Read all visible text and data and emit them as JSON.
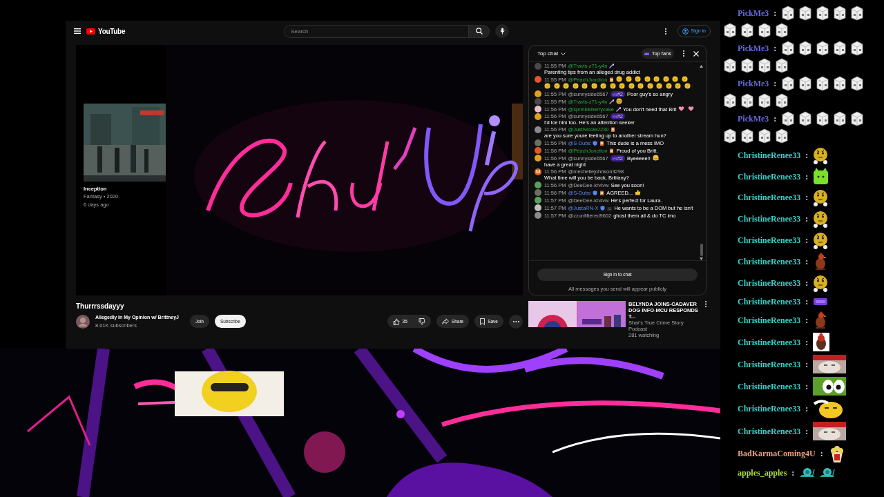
{
  "browser": {
    "logo": "YouTube",
    "search": {
      "placeholder": "Search"
    },
    "sign_in": "Sign in"
  },
  "player": {
    "suggestion": {
      "title": "Inception",
      "meta": "Fantasy • 2020",
      "age": "6 days ago"
    }
  },
  "video": {
    "title": "Thurrrssdayyy",
    "channel": "Allegedly In My Opinion w/ BrittneyJ",
    "subscribers": "8.01K subscribers",
    "join": "Join",
    "subscribe": "Subscribe",
    "likes": "35",
    "share": "Share",
    "save": "Save"
  },
  "chat": {
    "title": "Top chat",
    "filter": "Top fans",
    "messages": [
      {
        "time": "11:55 PM",
        "author": "@Travis-z71-y4n",
        "member": true,
        "moderator": false,
        "color": "#4a4a4a",
        "badges": [
          {
            "kind": "wand"
          }
        ],
        "parts": [
          {
            "kind": "text",
            "text": "Parenting tips from an alleged drug addict"
          }
        ]
      },
      {
        "time": "11:55 PM",
        "author": "@PeachJunction",
        "member": true,
        "moderator": false,
        "color": "#e0552a",
        "badges": [
          {
            "kind": "drink"
          }
        ],
        "parts": [
          {
            "kind": "clap"
          },
          {
            "kind": "clap"
          },
          {
            "kind": "clap"
          },
          {
            "kind": "clap"
          },
          {
            "kind": "clap"
          },
          {
            "kind": "clap"
          },
          {
            "kind": "clap"
          },
          {
            "kind": "clap"
          },
          {
            "kind": "clap"
          },
          {
            "kind": "clap"
          },
          {
            "kind": "clap"
          },
          {
            "kind": "clap"
          },
          {
            "kind": "clap"
          },
          {
            "kind": "clap"
          },
          {
            "kind": "clap"
          },
          {
            "kind": "clap"
          },
          {
            "kind": "clap"
          },
          {
            "kind": "clap"
          },
          {
            "kind": "clap"
          },
          {
            "kind": "clap"
          },
          {
            "kind": "clap"
          },
          {
            "kind": "clap"
          },
          {
            "kind": "clap"
          },
          {
            "kind": "clap"
          }
        ]
      },
      {
        "time": "11:55 PM",
        "author": "@sunnyside6567",
        "member": false,
        "moderator": false,
        "color": "#e0a020",
        "rank": "#2",
        "parts": [
          {
            "kind": "text",
            "text": "Poor guy's so angry"
          }
        ]
      },
      {
        "time": "11:55 PM",
        "author": "@Travis-z71-y4n",
        "member": true,
        "moderator": false,
        "color": "#4a4a4a",
        "badges": [
          {
            "kind": "wand"
          }
        ],
        "parts": [
          {
            "kind": "smile"
          }
        ]
      },
      {
        "time": "11:56 PM",
        "author": "@sprinkleberrycake",
        "member": true,
        "moderator": false,
        "color": "#e8c0c8",
        "badges": [
          {
            "kind": "wand"
          }
        ],
        "parts": [
          {
            "kind": "text",
            "text": "You don't need that Brit"
          },
          {
            "kind": "heart"
          },
          {
            "kind": "heart"
          }
        ]
      },
      {
        "time": "11:56 PM",
        "author": "@sunnyside6567",
        "member": false,
        "moderator": false,
        "color": "#e0a020",
        "rank": "#2",
        "parts": [
          {
            "kind": "text",
            "text": "I'd ice him too. He's an attention seeker"
          }
        ]
      },
      {
        "time": "11:56 PM",
        "author": "@JustNicole2230",
        "member": true,
        "moderator": false,
        "color": "#8a8a8a",
        "badges": [
          {
            "kind": "drink"
          }
        ],
        "parts": [
          {
            "kind": "text",
            "text": "are you sure youre feeling up to another stream hun?"
          }
        ]
      },
      {
        "time": "11:56 PM",
        "author": "@S-Dubs",
        "moderator": true,
        "color": "#6a7060",
        "badges": [
          {
            "kind": "shield"
          },
          {
            "kind": "drink"
          }
        ],
        "parts": [
          {
            "kind": "text",
            "text": "This dude is a mess IMO"
          }
        ]
      },
      {
        "time": "11:56 PM",
        "author": "@PeachJunction",
        "member": true,
        "moderator": false,
        "color": "#e0552a",
        "badges": [
          {
            "kind": "drink"
          }
        ],
        "parts": [
          {
            "kind": "text",
            "text": "Proud of you Britt."
          }
        ]
      },
      {
        "time": "11:56 PM",
        "author": "@sunnyside6567",
        "member": false,
        "moderator": false,
        "color": "#e0a020",
        "rank": "#2",
        "parts": [
          {
            "kind": "text",
            "text": "Byeeeee!!"
          },
          {
            "kind": "hug"
          },
          {
            "kind": "text",
            "text": "have a great night"
          }
        ]
      },
      {
        "time": "11:56 PM",
        "author": "@mechellejohnson3298",
        "member": false,
        "moderator": false,
        "color": "#e06a1a",
        "initial": "M",
        "parts": [
          {
            "kind": "text",
            "text": "What time will you be back, Brittany?"
          }
        ]
      },
      {
        "time": "11:56 PM",
        "author": "@DeeDee-kh4vw",
        "member": false,
        "moderator": false,
        "color": "#5aa060",
        "parts": [
          {
            "kind": "text",
            "text": "See you soon!"
          }
        ]
      },
      {
        "time": "11:56 PM",
        "author": "@S-Dubs",
        "moderator": true,
        "color": "#6a7060",
        "badges": [
          {
            "kind": "shield"
          },
          {
            "kind": "drink"
          }
        ],
        "parts": [
          {
            "kind": "text",
            "text": "AGREED..."
          },
          {
            "kind": "thumb"
          }
        ]
      },
      {
        "time": "11:57 PM",
        "author": "@DeeDee-kh4vw",
        "member": false,
        "moderator": false,
        "color": "#5aa060",
        "parts": [
          {
            "kind": "text",
            "text": "He's perfect for Laura."
          }
        ]
      },
      {
        "time": "11:57 PM",
        "author": "@JustaRN-X",
        "moderator": true,
        "color": "#c0c0c0",
        "badges": [
          {
            "kind": "shield"
          },
          {
            "kind": "dark"
          }
        ],
        "parts": [
          {
            "kind": "text",
            "text": "He wants to be a DOM but he isn't"
          }
        ]
      },
      {
        "time": "11:57 PM",
        "author": "@zzunfiltered9602",
        "member": false,
        "moderator": false,
        "color": "#8a8a8a",
        "parts": [
          {
            "kind": "text",
            "text": "ghost them all & do TC imo"
          }
        ]
      }
    ],
    "sign_in": "Sign in to chat",
    "note": "All messages you send will appear publicly"
  },
  "recommended": [
    {
      "title": "BELYNDA JOINS-CADAVER DOG INFO-MCU RESPONDS T...",
      "channel": "Shar's True Crime Story Podcast",
      "viewers": "281 watching"
    }
  ],
  "overlay": {
    "messages": [
      {
        "user": "PickMe3",
        "separator": ":",
        "color": "#6a6ae0",
        "emotes": [
          {
            "kind": "dice"
          },
          {
            "kind": "dice"
          },
          {
            "kind": "dice"
          },
          {
            "kind": "dice"
          },
          {
            "kind": "dice"
          },
          {
            "kind": "dice"
          },
          {
            "kind": "dice"
          },
          {
            "kind": "dice"
          },
          {
            "kind": "dice"
          }
        ]
      },
      {
        "user": "PickMe3",
        "separator": ":",
        "color": "#6a6ae0",
        "emotes": [
          {
            "kind": "dice"
          },
          {
            "kind": "dice"
          },
          {
            "kind": "dice"
          },
          {
            "kind": "dice"
          },
          {
            "kind": "dice"
          },
          {
            "kind": "dice"
          },
          {
            "kind": "dice"
          },
          {
            "kind": "dice"
          },
          {
            "kind": "dice"
          }
        ]
      },
      {
        "user": "PickMe3",
        "separator": ":",
        "color": "#6a6ae0",
        "emotes": [
          {
            "kind": "dice"
          },
          {
            "kind": "dice"
          },
          {
            "kind": "dice"
          },
          {
            "kind": "dice"
          },
          {
            "kind": "dice"
          },
          {
            "kind": "dice"
          },
          {
            "kind": "dice"
          },
          {
            "kind": "dice"
          },
          {
            "kind": "dice"
          }
        ]
      },
      {
        "user": "PickMe3",
        "separator": ":",
        "color": "#6a6ae0",
        "emotes": [
          {
            "kind": "dice"
          },
          {
            "kind": "dice"
          },
          {
            "kind": "dice"
          },
          {
            "kind": "dice"
          },
          {
            "kind": "dice"
          },
          {
            "kind": "dice"
          },
          {
            "kind": "dice"
          },
          {
            "kind": "dice"
          },
          {
            "kind": "dice"
          }
        ]
      },
      {
        "user": "ChristineRenee33",
        "separator": ":",
        "color": "#38d0c8",
        "emotes": [
          {
            "kind": "smiley"
          }
        ]
      },
      {
        "user": "ChristineRenee33",
        "separator": ":",
        "color": "#38d0c8",
        "emotes": [
          {
            "kind": "green-cat"
          }
        ]
      },
      {
        "user": "ChristineRenee33",
        "separator": ":",
        "color": "#38d0c8",
        "emotes": [
          {
            "kind": "smiley"
          }
        ]
      },
      {
        "user": "ChristineRenee33",
        "separator": ":",
        "color": "#38d0c8",
        "emotes": [
          {
            "kind": "smiley"
          }
        ]
      },
      {
        "user": "ChristineRenee33",
        "separator": ":",
        "color": "#38d0c8",
        "emotes": [
          {
            "kind": "smiley"
          }
        ]
      },
      {
        "user": "ChristineRenee33",
        "separator": ":",
        "color": "#38d0c8",
        "emotes": [
          {
            "kind": "rooster"
          }
        ]
      },
      {
        "user": "ChristineRenee33",
        "separator": ":",
        "color": "#38d0c8",
        "emotes": [
          {
            "kind": "smiley"
          }
        ]
      },
      {
        "user": "ChristineRenee33",
        "separator": ":",
        "color": "#38d0c8",
        "emotes": [
          {
            "kind": "sticker"
          }
        ]
      },
      {
        "user": "ChristineRenee33",
        "separator": ":",
        "color": "#38d0c8",
        "emotes": [
          {
            "kind": "rooster"
          }
        ]
      },
      {
        "user": "ChristineRenee33",
        "separator": ":",
        "color": "#38d0c8",
        "emotes": [
          {
            "kind": "rooster-tile"
          }
        ]
      },
      {
        "user": "ChristineRenee33",
        "separator": ":",
        "color": "#38d0c8",
        "emotes": [
          {
            "kind": "cat-photo"
          }
        ]
      },
      {
        "user": "ChristineRenee33",
        "separator": ":",
        "color": "#38d0c8",
        "emotes": [
          {
            "kind": "frog"
          }
        ]
      },
      {
        "user": "ChristineRenee33",
        "separator": ":",
        "color": "#38d0c8",
        "emotes": [
          {
            "kind": "smiley-wide"
          }
        ]
      },
      {
        "user": "ChristineRenee33",
        "separator": ":",
        "color": "#38d0c8",
        "emotes": [
          {
            "kind": "cat-photo"
          }
        ]
      },
      {
        "user": "BadKarmaComing4U",
        "separator": ":",
        "color": "#e8a080",
        "emotes": [
          {
            "kind": "popcorn"
          }
        ]
      },
      {
        "user": "apples_apples",
        "separator": ":",
        "color": "#b0e030",
        "emotes": [
          {
            "kind": "snail"
          },
          {
            "kind": "snail"
          }
        ]
      }
    ]
  }
}
